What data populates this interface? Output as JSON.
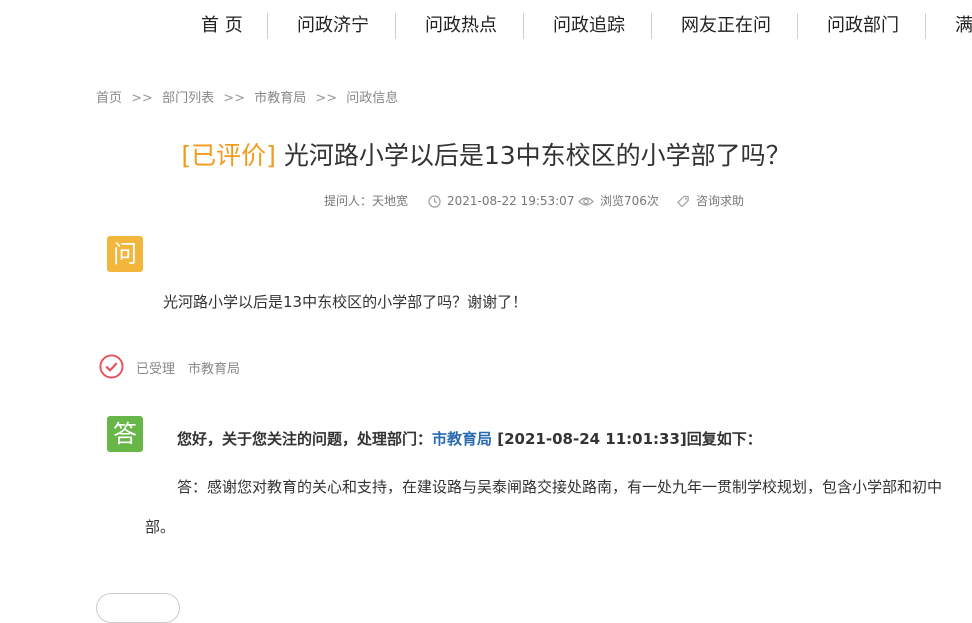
{
  "nav": {
    "items": [
      "首 页",
      "问政济宁",
      "问政热点",
      "问政追踪",
      "网友正在问",
      "问政部门",
      "满"
    ]
  },
  "breadcrumb": {
    "items": [
      "首页",
      "部门列表",
      "市教育局",
      "问政信息"
    ],
    "separator": ">>"
  },
  "question": {
    "status_tag": "[已评价]",
    "title": "光河路小学以后是13中东校区的小学部了吗？",
    "meta": {
      "asker": "提问人：天地宽",
      "datetime": "2021-08-22 19:53:07",
      "views": "浏览706次",
      "category": "咨询求助"
    },
    "badge": "问",
    "body": "光河路小学以后是13中东校区的小学部了吗？谢谢了！"
  },
  "status": {
    "label": "已受理",
    "department": "市教育局"
  },
  "reply": {
    "badge": "答",
    "header_prefix": "您好，关于您关注的问题，处理部门：",
    "department": "市教育局",
    "header_suffix": "[2021-08-24 11:01:33]回复如下：",
    "body": "答：感谢您对教育的关心和支持，在建设路与吴泰闸路交接处路南，有一处九年一贯制学校规划，包含小学部和初中部。"
  },
  "colors": {
    "tag": "#f29a1c",
    "question_badge": "#f3b63d",
    "answer_badge": "#67b648",
    "accepted_icon": "#e9505a",
    "department_link": "#2a6bb0"
  }
}
